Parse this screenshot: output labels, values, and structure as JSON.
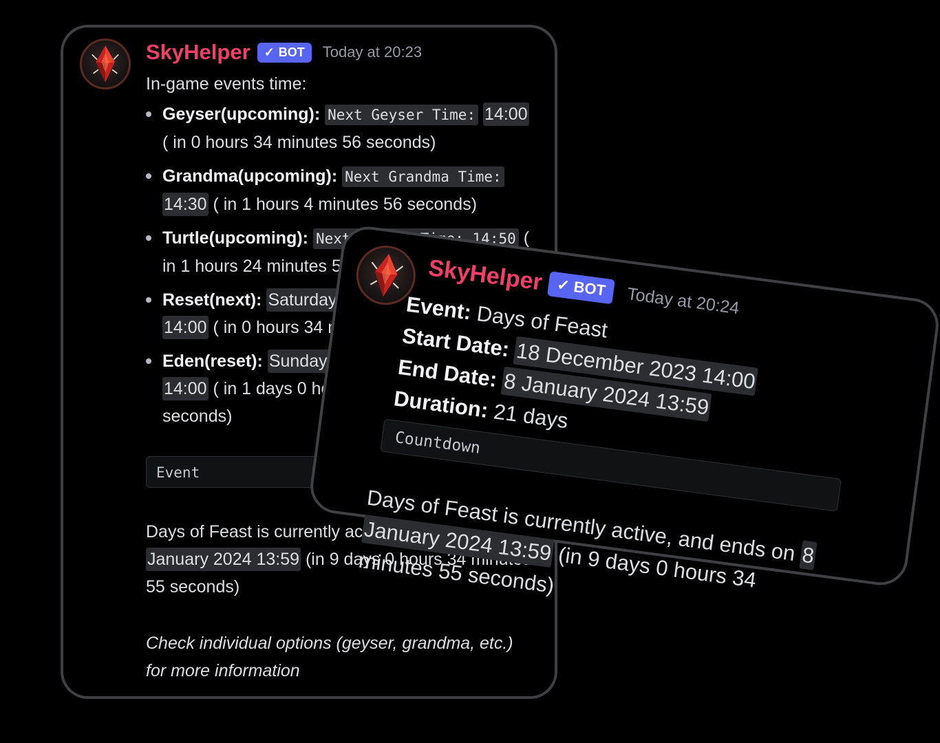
{
  "message_back": {
    "username": "SkyHelper",
    "badge": "BOT",
    "timestamp": "Today at 20:23",
    "intro": "In-game events time:",
    "events": [
      {
        "name": "Geyser(upcoming):",
        "code": "Next Geyser Time:",
        "time": "14:00",
        "rest": " ( in 0 hours 34 minutes 56 seconds)"
      },
      {
        "name": "Grandma(upcoming):",
        "code": "Next Grandma Time:",
        "time": "14:30",
        "rest": " ( in 1 hours 4 minutes 56 seconds)"
      },
      {
        "name": "Turtle(upcoming):",
        "code": "Next Turtle Time: 14:50",
        "time": "",
        "rest": " ( in 1 hours 24 minutes 56 seconds)"
      },
      {
        "name": "Reset(next):",
        "code": "Saturday, 30 December 2023",
        "time": "14:00",
        "rest": " ( in 0 hours 34 minutes 56 seconds)"
      },
      {
        "name": "Eden(reset):",
        "code": "Sunday, 31 December 2023",
        "time": "14:00",
        "rest": " ( in 1 days 0 hours 34 minutes 56 seconds)"
      }
    ],
    "field_title": "Event",
    "active_prefix": "Days of Feast is currently active, and ends on 8",
    "active_highlight": "January 2024 13:59",
    "active_suffix": " (in 9 days 0 hours 34 minutes 55 seconds)",
    "footer": "Check individual options (geyser, grandma, etc.) for more information"
  },
  "message_front": {
    "username": "SkyHelper",
    "badge": "BOT",
    "timestamp": "Today at 20:24",
    "event_label": "Event:",
    "event_value": "Days of Feast",
    "start_label": "Start Date:",
    "start_value": "18 December 2023 14:00",
    "end_label": "End Date:",
    "end_value": "8 January 2024 13:59",
    "duration_label": "Duration:",
    "duration_value": "21 days",
    "field_title": "Countdown",
    "active_prefix": "Days of Feast is currently active, and ends on ",
    "active_highlight_1": "8",
    "active_highlight_2": "January 2024 13:59",
    "active_suffix": " (in 9 days 0 hours 34 minutes 55 seconds)"
  },
  "icons": {
    "avatar": "red-crystal-avatar-icon",
    "verified": "checkmark-icon",
    "bullet": "bullet-dot-icon"
  },
  "colors": {
    "background": "#000000",
    "username": "#f23f6a",
    "badge": "#5865f2",
    "timestamp": "#949ba4",
    "code_bg": "#2b2d31"
  }
}
